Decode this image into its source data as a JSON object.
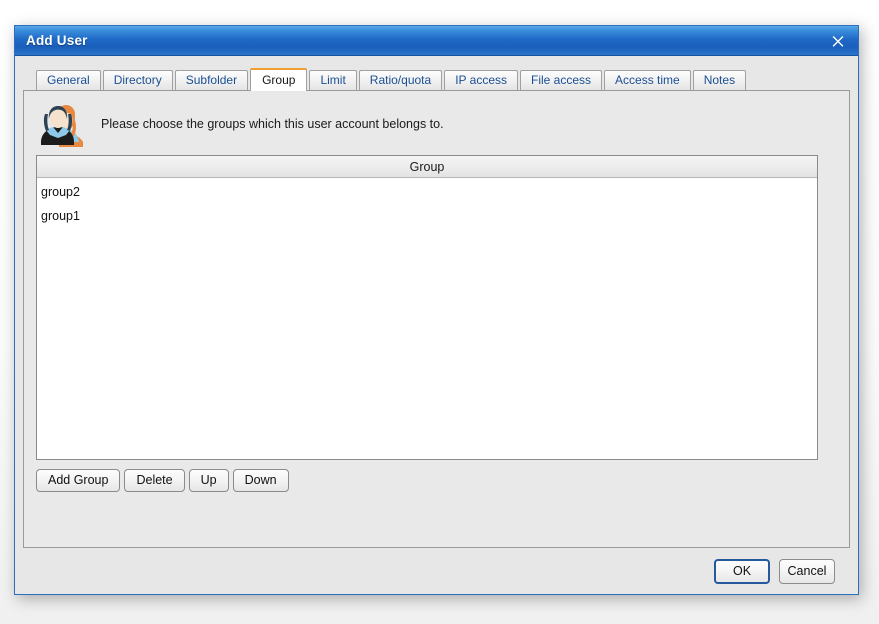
{
  "window": {
    "title": "Add User",
    "close_icon": "close-x-icon",
    "accent_blue": "#1f69c6",
    "active_tab_accent": "#f0a030"
  },
  "tabs": [
    {
      "label": "General",
      "active": false
    },
    {
      "label": "Directory",
      "active": false
    },
    {
      "label": "Subfolder",
      "active": false
    },
    {
      "label": "Group",
      "active": true
    },
    {
      "label": "Limit",
      "active": false
    },
    {
      "label": "Ratio/quota",
      "active": false
    },
    {
      "label": "IP access",
      "active": false
    },
    {
      "label": "File access",
      "active": false
    },
    {
      "label": "Access time",
      "active": false
    },
    {
      "label": "Notes",
      "active": false
    }
  ],
  "panel": {
    "avatar_icon": "two-users-avatar-icon",
    "instruction": "Please choose the groups which this user account belongs to.",
    "list": {
      "column_header": "Group",
      "rows": [
        {
          "name": "group2"
        },
        {
          "name": "group1"
        }
      ]
    },
    "actions": [
      {
        "label": "Add Group"
      },
      {
        "label": "Delete"
      },
      {
        "label": "Up"
      },
      {
        "label": "Down"
      }
    ]
  },
  "footer": {
    "ok_label": "OK",
    "cancel_label": "Cancel"
  }
}
